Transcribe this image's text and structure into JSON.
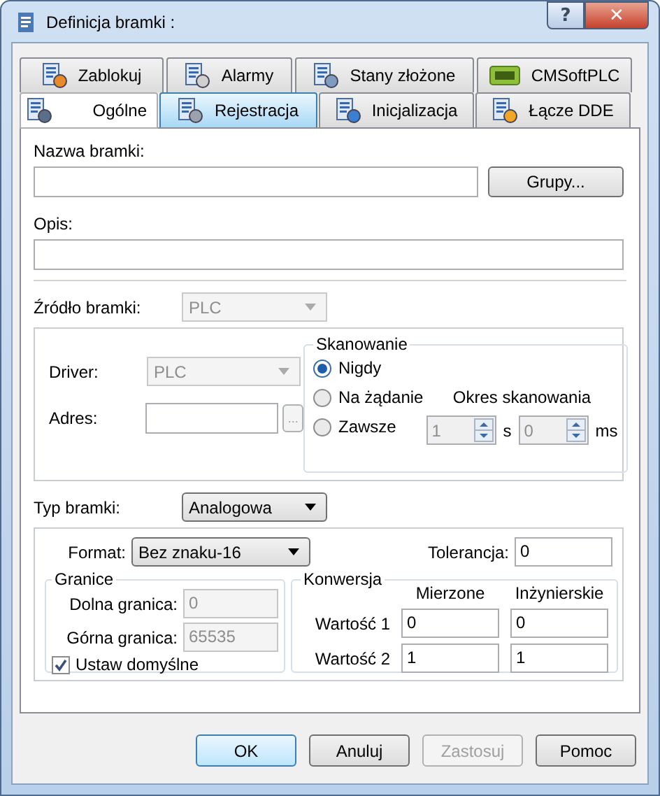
{
  "window": {
    "title": "Definicja bramki :",
    "title_buttons": [
      "?",
      "✕"
    ]
  },
  "tab_rows": [
    [
      {
        "label": "Zablokuj",
        "selected": false,
        "highlighted": false
      },
      {
        "label": "Alarmy",
        "selected": false,
        "highlighted": false
      },
      {
        "label": "Stany złożone",
        "selected": false,
        "highlighted": false
      },
      {
        "label": "CMSoftPLC",
        "selected": false,
        "highlighted": false
      }
    ],
    [
      {
        "label": "Ogólne",
        "selected": true,
        "highlighted": false
      },
      {
        "label": "Rejestracja",
        "selected": false,
        "highlighted": true
      },
      {
        "label": "Inicjalizacja",
        "selected": false,
        "highlighted": false
      },
      {
        "label": "Łącze DDE",
        "selected": false,
        "highlighted": false
      }
    ]
  ],
  "name": {
    "label": "Nazwa bramki:",
    "button": "Grupy..."
  },
  "description": {
    "label": "Opis:"
  },
  "source": {
    "label": "Źródło bramki:",
    "value": "PLC",
    "disabled": true
  },
  "driver": {
    "label": "Driver:",
    "value": "PLC",
    "disabled": true
  },
  "address": {
    "label": "Adres:",
    "browse": "...",
    "browse_disabled": true
  },
  "scanning": {
    "title": "Skanowanie",
    "options": [
      {
        "label": "Nigdy",
        "selected": true
      },
      {
        "label": "Na żądanie",
        "selected": false
      },
      {
        "label": "Zawsze",
        "selected": false
      }
    ],
    "period_label": "Okres skanowania",
    "spins": [
      {
        "value": "1",
        "unit": "s",
        "disabled": true
      },
      {
        "value": "0",
        "unit": "ms",
        "disabled": true
      }
    ]
  },
  "type": {
    "label": "Typ bramki:",
    "value": "Analogowa"
  },
  "format": {
    "label": "Format:",
    "value": "Bez znaku-16"
  },
  "tolerance": {
    "label": "Tolerancja:",
    "value": "0"
  },
  "limits": {
    "title": "Granice",
    "rows": [
      {
        "label": "Dolna granica:",
        "value": "0",
        "disabled": true
      },
      {
        "label": "Górna granica:",
        "value": "65535",
        "disabled": true
      }
    ],
    "default": {
      "label": "Ustaw domyślne",
      "checked": true
    }
  },
  "conversion": {
    "title": "Konwersja",
    "columns": [
      "Mierzone",
      "Inżynierskie"
    ],
    "rows": [
      {
        "label": "Wartość 1",
        "values": [
          "0",
          "0"
        ]
      },
      {
        "label": "Wartość 2",
        "values": [
          "1",
          "1"
        ]
      }
    ]
  },
  "buttons": [
    {
      "label": "OK",
      "default": true,
      "disabled": false
    },
    {
      "label": "Anuluj",
      "default": false,
      "disabled": false
    },
    {
      "label": "Zastosuj",
      "default": false,
      "disabled": true
    },
    {
      "label": "Pomoc",
      "default": false,
      "disabled": false
    }
  ]
}
